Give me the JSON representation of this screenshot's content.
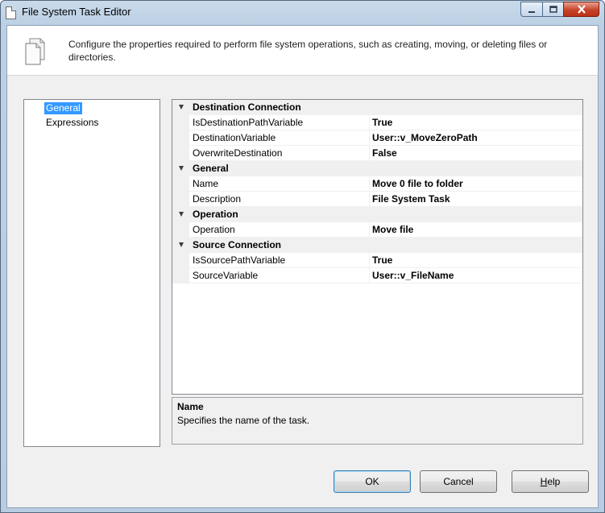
{
  "window": {
    "title": "File System Task Editor"
  },
  "header": {
    "description": "Configure the properties required to perform file system operations, such as creating, moving, or deleting files or directories."
  },
  "nav": {
    "items": [
      {
        "label": "General",
        "selected": true
      },
      {
        "label": "Expressions",
        "selected": false
      }
    ]
  },
  "properties": {
    "categories": [
      {
        "name": "Destination Connection",
        "rows": [
          {
            "name": "IsDestinationPathVariable",
            "value": "True"
          },
          {
            "name": "DestinationVariable",
            "value": "User::v_MoveZeroPath"
          },
          {
            "name": "OverwriteDestination",
            "value": "False"
          }
        ]
      },
      {
        "name": "General",
        "rows": [
          {
            "name": "Name",
            "value": "Move 0 file to folder"
          },
          {
            "name": "Description",
            "value": "File System Task"
          }
        ]
      },
      {
        "name": "Operation",
        "rows": [
          {
            "name": "Operation",
            "value": "Move file"
          }
        ]
      },
      {
        "name": "Source Connection",
        "rows": [
          {
            "name": "IsSourcePathVariable",
            "value": "True"
          },
          {
            "name": "SourceVariable",
            "value": "User::v_FileName"
          }
        ]
      }
    ]
  },
  "help": {
    "title": "Name",
    "text": "Specifies the name of the task."
  },
  "buttons": {
    "ok": "OK",
    "cancel": "Cancel",
    "help_mnemonic": "H",
    "help_rest": "elp"
  },
  "colors": {
    "selection": "#3399ff",
    "close_button": "#c7432a"
  },
  "icons": {
    "window_icon": "document-icon",
    "header_icon": "documents-icon",
    "expand": "triangle-down-icon"
  }
}
